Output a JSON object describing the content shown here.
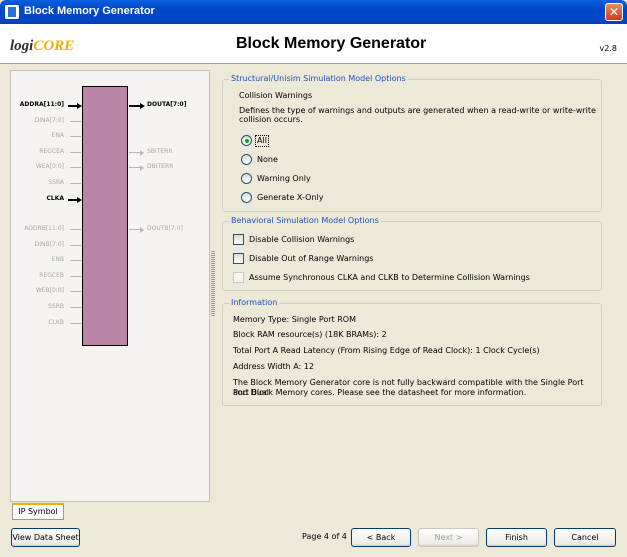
{
  "window": {
    "title": "Block Memory Generator",
    "close_glyph": "✕"
  },
  "header": {
    "logo_prefix": "logi",
    "logo_suffix": "CORE",
    "title": "Block Memory Generator",
    "version": "v2.8"
  },
  "symbol": {
    "left_pins": [
      {
        "label": "ADDRA[11:0]",
        "active": true
      },
      {
        "label": "DINA[7:0]",
        "active": false
      },
      {
        "label": "ENA",
        "active": false
      },
      {
        "label": "REGCEA",
        "active": false
      },
      {
        "label": "WEA[0:0]",
        "active": false
      },
      {
        "label": "SSRA",
        "active": false
      },
      {
        "label": "CLKA",
        "active": true
      },
      {
        "label": "ADDRB[11:0]",
        "active": false
      },
      {
        "label": "DINB[7:0]",
        "active": false
      },
      {
        "label": "ENB",
        "active": false
      },
      {
        "label": "REGCEB",
        "active": false
      },
      {
        "label": "WEB[0:0]",
        "active": false
      },
      {
        "label": "SSRB",
        "active": false
      },
      {
        "label": "CLKB",
        "active": false
      }
    ],
    "right_pins": [
      {
        "label": "DOUTA[7:0]",
        "active": true
      },
      {
        "label": "SBITERR",
        "active": false
      },
      {
        "label": "DBITERR",
        "active": false
      },
      {
        "label": "DOUTB[7:0]",
        "active": false
      }
    ],
    "tab_label": "IP Symbol",
    "block_color": "#B986A8"
  },
  "structural": {
    "legend": "Structural/Unisim Simulation Model Options",
    "subtitle": "Collision Warnings",
    "description_1": "Defines the type of warnings and outputs are generated when a read-write or write-write",
    "description_2": "collision occurs.",
    "options": [
      "All",
      "None",
      "Warning Only",
      "Generate X-Only"
    ],
    "selected": "All"
  },
  "behavioral": {
    "legend": "Behavioral Simulation Model Options",
    "disable_collision": "Disable Collision Warnings",
    "disable_out_of_range": "Disable Out of Range Warnings",
    "assume_sync": "Assume Synchronous CLKA and CLKB to Determine Collision Warnings"
  },
  "information": {
    "legend": "Information",
    "memory_type": "Memory Type: Single Port ROM",
    "block_ram": "Block RAM resource(s) (18K BRAMs): 2",
    "latency": "Total Port A Read Latency (From Rising Edge of Read Clock): 1 Clock Cycle(s)",
    "address_width": "Address Width A: 12",
    "note_1": "The Block Memory Generator core is not fully backward compatible with the Single Port and Dual",
    "note_2": "Port Block Memory cores. Please see the datasheet for more information."
  },
  "footer": {
    "view_data_sheet": "View Data Sheet",
    "page": "Page 4 of 4",
    "back": "< Back",
    "next": "Next >",
    "finish": "Finish",
    "cancel": "Cancel"
  },
  "colors": {
    "titlebar": "#0047C6",
    "legend": "#1E4FBF",
    "accent": "#F0B000"
  }
}
